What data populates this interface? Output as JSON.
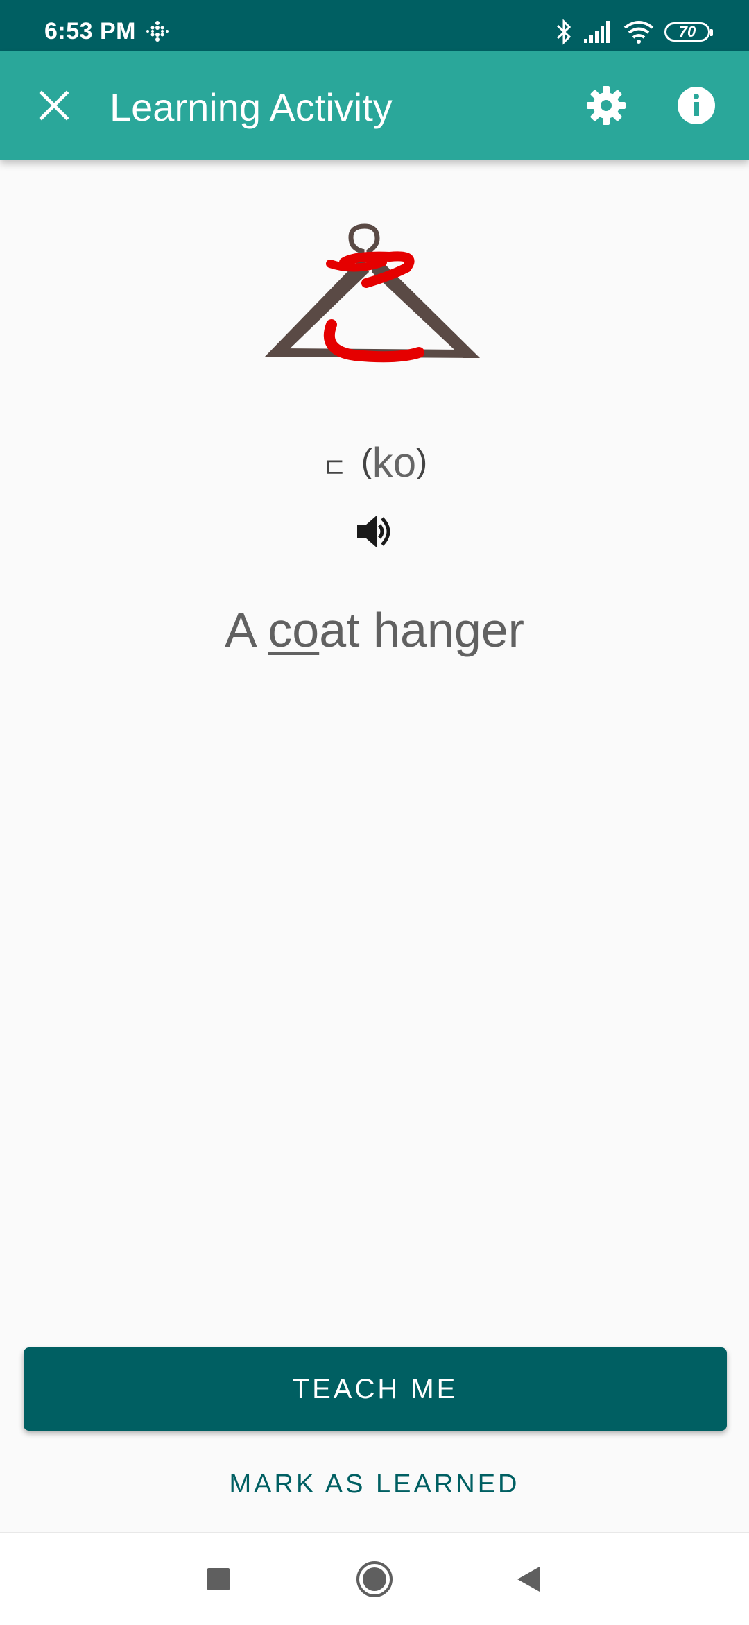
{
  "status_bar": {
    "time": "6:53 PM",
    "battery": "70",
    "icons": [
      "grid-dots-icon",
      "bluetooth-icon",
      "signal-icon",
      "wifi-icon",
      "battery-icon"
    ]
  },
  "app_bar": {
    "title": "Learning Activity",
    "icons": [
      "close-icon",
      "settings-gear-icon",
      "info-icon"
    ]
  },
  "lesson": {
    "glyph": "ㄷ",
    "romanization_open": "(",
    "romanization": "ko",
    "romanization_close": ")",
    "mnemonic_prefix": "A ",
    "mnemonic_highlight": "co",
    "mnemonic_suffix": "at hanger",
    "illustration": "coat-hanger-illustration",
    "audio_icon": "speaker-icon"
  },
  "actions": {
    "teach_me": "TEACH ME",
    "mark_as_learned": "MARK AS LEARNED"
  },
  "navigation": {
    "icons": [
      "recents-square-icon",
      "home-circle-icon",
      "back-triangle-icon"
    ]
  },
  "colors": {
    "status_bar": "#005f62",
    "app_bar": "#2aa79a",
    "primary_button": "#005f62",
    "text_secondary": "#616161",
    "hanger_stroke": "#e50000"
  }
}
